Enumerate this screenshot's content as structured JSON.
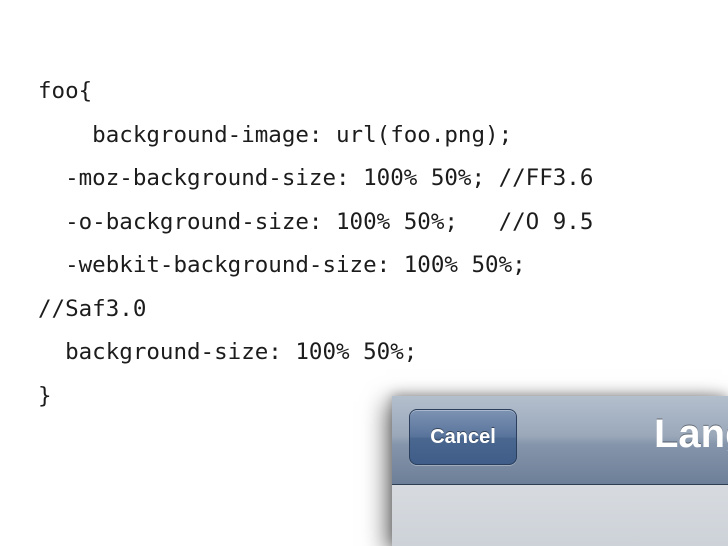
{
  "code": {
    "lines": [
      "foo{",
      "    background-image: url(foo.png);",
      "  -moz-background-size: 100% 50%; //FF3.6",
      "  -o-background-size: 100% 50%;   //O 9.5",
      "  -webkit-background-size: 100% 50%;",
      "//Saf3.0",
      "  background-size: 100% 50%;",
      "}"
    ]
  },
  "phone_toolbar": {
    "cancel_label": "Cancel",
    "title": "Lang"
  },
  "colors": {
    "code_text": "#1c1c1c",
    "toolbar_top": "#b4bfcd",
    "toolbar_bottom": "#6d7f98",
    "button_fill": "#4a6790"
  }
}
